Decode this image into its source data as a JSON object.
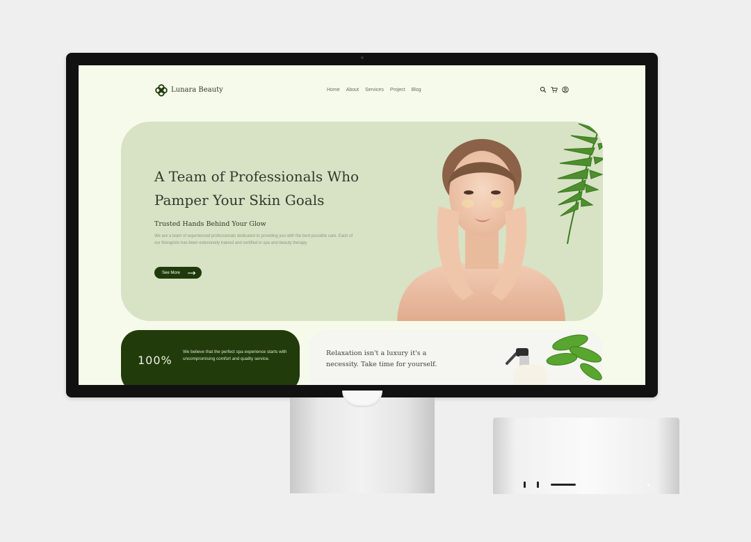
{
  "site": {
    "brand": "Lunara Beauty",
    "nav": [
      "Home",
      "About",
      "Services",
      "Project",
      "Blog"
    ],
    "icons": [
      "search-icon",
      "cart-icon",
      "user-icon"
    ]
  },
  "hero": {
    "headline": "A Team of Professionals Who Pamper Your Skin Goals",
    "subheading": "Trusted Hands Behind Your Glow",
    "description": "We are a team of experienced professionals dedicated to providing you with the best possible care. Each of our therapists has been extensively trained and certified in spa and beauty therapy.",
    "cta_label": "See More"
  },
  "stats": {
    "value": "100%",
    "text": "We believe that the perfect spa experience starts with uncompromising comfort and quality service."
  },
  "quote": {
    "text": "Relaxation isn't a luxury it's a necessity. Take time for yourself."
  },
  "colors": {
    "background": "#f6faea",
    "hero": "#d8e2c5",
    "accent": "#213b0b"
  }
}
